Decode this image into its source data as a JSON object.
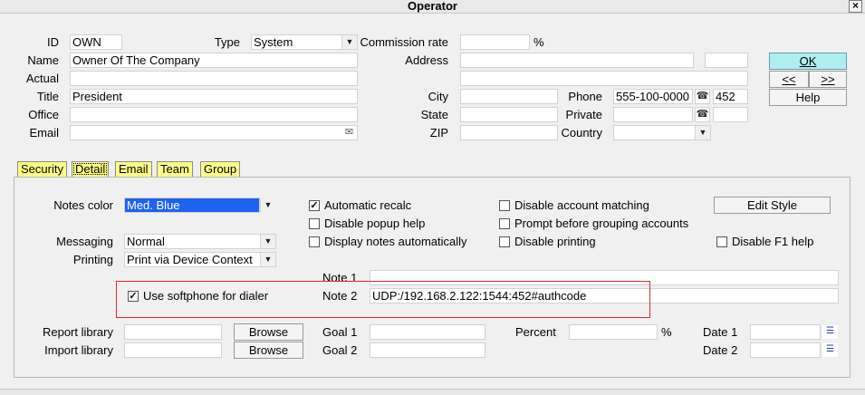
{
  "window": {
    "title": "Operator",
    "close": "×"
  },
  "header": {
    "id_label": "ID",
    "id_value": "OWN",
    "type_label": "Type",
    "type_value": "System",
    "commission_label": "Commission rate",
    "commission_value": "",
    "commission_unit": "%",
    "name_label": "Name",
    "name_value": "Owner Of The Company",
    "address_label": "Address",
    "address1": "",
    "address_extra": "",
    "actual_label": "Actual",
    "actual_value": "",
    "address2": "",
    "title_label": "Title",
    "title_value": "President",
    "city_label": "City",
    "city_value": "",
    "phone_label": "Phone",
    "phone_value": "555-100-0000",
    "phone_ext": "452",
    "office_label": "Office",
    "office_value": "",
    "state_label": "State",
    "state_value": "",
    "private_label": "Private",
    "private_value": "",
    "private_ext": "",
    "email_label": "Email",
    "email_value": "",
    "zip_label": "ZIP",
    "zip_value": "",
    "country_label": "Country",
    "country_value": ""
  },
  "buttons": {
    "ok": "OK",
    "prev": "<<",
    "next": ">>",
    "help": "Help"
  },
  "tabs": [
    {
      "label": "Security"
    },
    {
      "label": "Detail",
      "active": true
    },
    {
      "label": "Email"
    },
    {
      "label": "Team"
    },
    {
      "label": "Group"
    }
  ],
  "detail": {
    "notes_color_label": "Notes color",
    "notes_color_value": "Med. Blue",
    "notes_color_swatch": "#1e62f0",
    "messaging_label": "Messaging",
    "messaging_value": "Normal",
    "printing_label": "Printing",
    "printing_value": "Print via Device Context",
    "auto_recalc": {
      "label": "Automatic recalc",
      "checked": true
    },
    "disable_popup_help": {
      "label": "Disable popup help",
      "checked": false
    },
    "display_notes_auto": {
      "label": "Display notes automatically",
      "checked": false
    },
    "disable_account_matching": {
      "label": "Disable account matching",
      "checked": false
    },
    "prompt_grouping": {
      "label": "Prompt before grouping accounts",
      "checked": false
    },
    "disable_printing": {
      "label": "Disable printing",
      "checked": false
    },
    "edit_style": "Edit Style",
    "disable_f1": {
      "label": "Disable F1 help",
      "checked": false
    },
    "note1_label": "Note 1",
    "note1_value": "",
    "use_softphone": {
      "label": "Use softphone for dialer",
      "checked": true
    },
    "note2_label": "Note 2",
    "note2_value": "UDP:/192.168.2.122:1544:452#authcode",
    "report_library_label": "Report library",
    "report_library_value": "",
    "import_library_label": "Import library",
    "import_library_value": "",
    "browse": "Browse",
    "goal1_label": "Goal 1",
    "goal1_value": "",
    "goal2_label": "Goal 2",
    "goal2_value": "",
    "percent_label": "Percent",
    "percent_value": "",
    "percent_unit": "%",
    "date1_label": "Date 1",
    "date1_value": "",
    "date2_label": "Date 2",
    "date2_value": ""
  }
}
